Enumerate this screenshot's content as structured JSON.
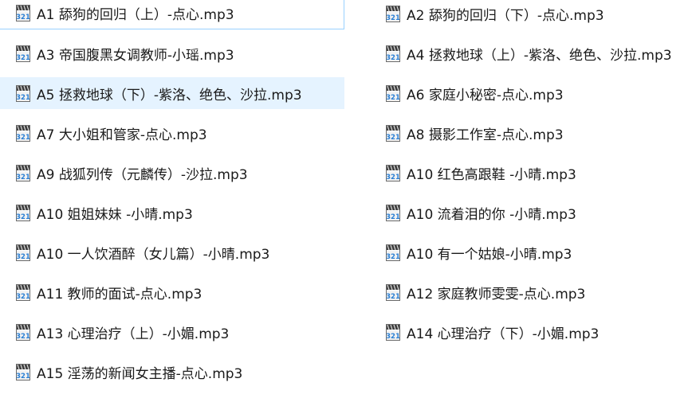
{
  "files": [
    {
      "name": "A1 舔狗的回归（上）-点心.mp3",
      "col": 0,
      "row": 0,
      "state": "focused"
    },
    {
      "name": "A2 舔狗的回归（下）-点心.mp3",
      "col": 1,
      "row": 0,
      "state": ""
    },
    {
      "name": "A3 帝国腹黑女调教师-小瑶.mp3",
      "col": 0,
      "row": 1,
      "state": ""
    },
    {
      "name": "A4 拯救地球（上）-紫洛、绝色、沙拉.mp3",
      "col": 1,
      "row": 1,
      "state": ""
    },
    {
      "name": "A5 拯救地球（下）-紫洛、绝色、沙拉.mp3",
      "col": 0,
      "row": 2,
      "state": "selected"
    },
    {
      "name": "A6 家庭小秘密-点心.mp3",
      "col": 1,
      "row": 2,
      "state": ""
    },
    {
      "name": "A7 大小姐和管家-点心.mp3",
      "col": 0,
      "row": 3,
      "state": ""
    },
    {
      "name": "A8 摄影工作室-点心.mp3",
      "col": 1,
      "row": 3,
      "state": ""
    },
    {
      "name": "A9 战狐列传（元麟传）-沙拉.mp3",
      "col": 0,
      "row": 4,
      "state": ""
    },
    {
      "name": "A10 红色高跟鞋 -小晴.mp3",
      "col": 1,
      "row": 4,
      "state": ""
    },
    {
      "name": "A10 姐姐妹妹 -小晴.mp3",
      "col": 0,
      "row": 5,
      "state": ""
    },
    {
      "name": "A10 流着泪的你 -小晴.mp3",
      "col": 1,
      "row": 5,
      "state": ""
    },
    {
      "name": "A10 一人饮酒醉（女儿篇）-小晴.mp3",
      "col": 0,
      "row": 6,
      "state": ""
    },
    {
      "name": "A10 有一个姑娘-小晴.mp3",
      "col": 1,
      "row": 6,
      "state": ""
    },
    {
      "name": "A11 教师的面试-点心.mp3",
      "col": 0,
      "row": 7,
      "state": ""
    },
    {
      "name": "A12 家庭教师雯雯-点心.mp3",
      "col": 1,
      "row": 7,
      "state": ""
    },
    {
      "name": "A13 心理治疗（上）-小媚.mp3",
      "col": 0,
      "row": 8,
      "state": ""
    },
    {
      "name": "A14 心理治疗（下）-小媚.mp3",
      "col": 1,
      "row": 8,
      "state": ""
    },
    {
      "name": "A15 淫荡的新闻女主播-点心.mp3",
      "col": 0,
      "row": 9,
      "state": ""
    }
  ],
  "icon": {
    "name": "media-file-icon",
    "label_text": "321"
  },
  "colors": {
    "selected_bg": "#e5f3ff",
    "focus_border": "#99d1ff",
    "text": "#1a1a1a"
  }
}
